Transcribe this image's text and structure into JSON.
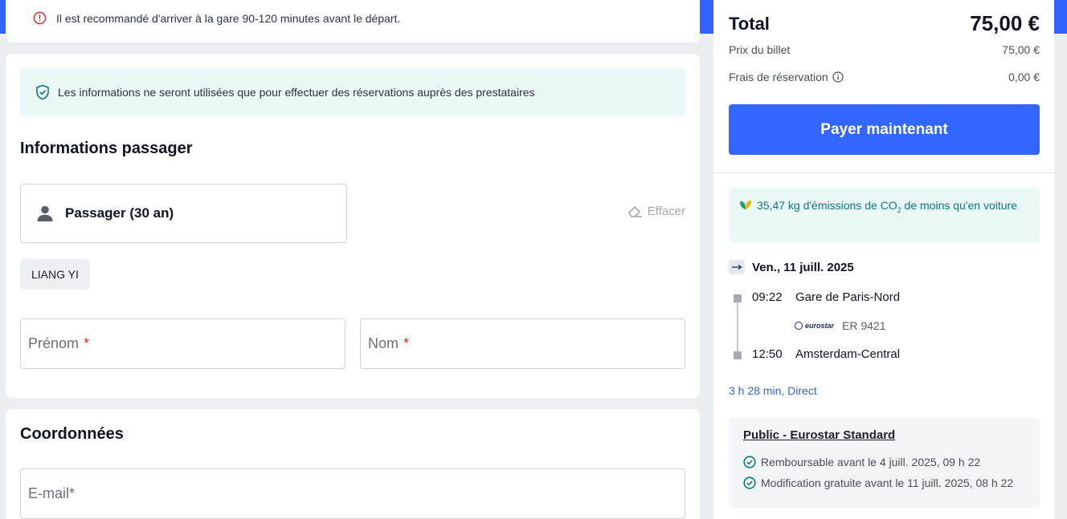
{
  "notice": {
    "text": "Il est recommandé d'arriver à la gare 90-120 minutes avant le départ."
  },
  "privacy": {
    "text": "Les informations ne seront utilisées que pour effectuer des réservations auprès des prestataires"
  },
  "passenger_section": {
    "title": "Informations passager",
    "passenger_label": "Passager (30 an)",
    "clear_label": "Effacer",
    "saved_name_chip": "LIANG YI",
    "first_name_placeholder": "Prénom",
    "last_name_placeholder": "Nom",
    "required_mark": "*"
  },
  "contact_section": {
    "title": "Coordonnées",
    "email_placeholder": "E-mail*"
  },
  "summary": {
    "total_label": "Total",
    "total_value": "75,00 €",
    "ticket_label": "Prix du billet",
    "ticket_value": "75,00 €",
    "fee_label": "Frais de réservation",
    "fee_value": "0,00 €",
    "pay_button": "Payer maintenant"
  },
  "eco": {
    "text_before": "35,47 kg d'émissions de CO",
    "subscript": "2",
    "text_after": " de moins qu'en voiture"
  },
  "trip": {
    "date": "Ven., 11 juill. 2025",
    "departure_time": "09:22",
    "departure_station": "Gare de Paris-Nord",
    "operator_logo": "eurostar",
    "train_number": "ER 9421",
    "arrival_time": "12:50",
    "arrival_station": "Amsterdam-Central",
    "duration": "3 h 28 min, Direct"
  },
  "fare": {
    "title": "Public - Eurostar Standard",
    "conditions": [
      "Remboursable avant le 4 juill. 2025, 09 h 22",
      "Modification gratuite avant le 11 juill. 2025, 08 h 22"
    ]
  },
  "colors": {
    "brand_blue": "#3161ff",
    "eco_green": "#0b7a70",
    "error_red": "#d92b2b"
  }
}
